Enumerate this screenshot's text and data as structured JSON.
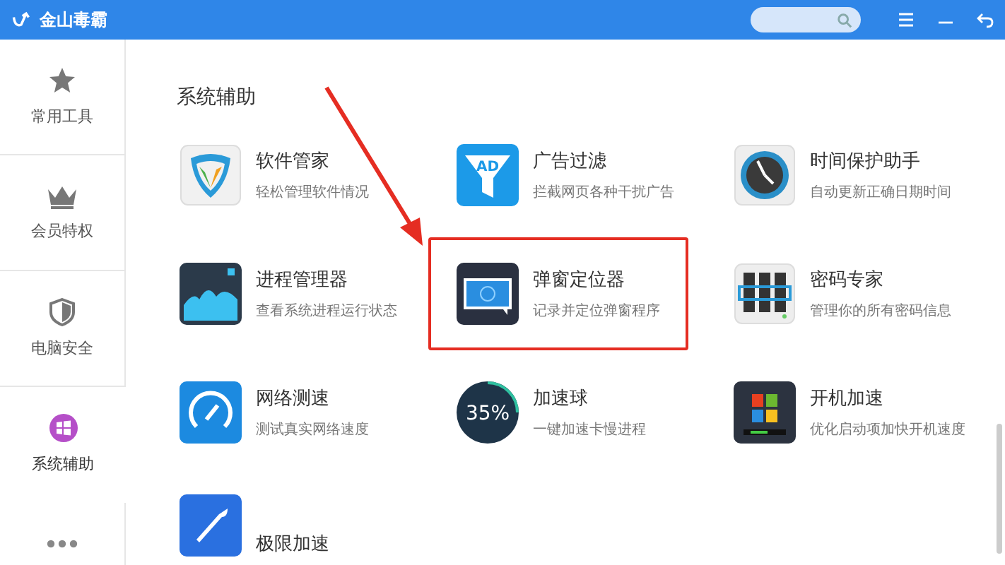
{
  "window": {
    "title": "金山毒霸"
  },
  "sidebar": {
    "items": [
      {
        "label": "常用工具",
        "kind": "star",
        "selected": false
      },
      {
        "label": "会员特权",
        "kind": "crown",
        "selected": false
      },
      {
        "label": "电脑安全",
        "kind": "shield",
        "selected": false
      },
      {
        "label": "系统辅助",
        "kind": "windows",
        "selected": true
      },
      {
        "kind": "more",
        "selected": false
      }
    ]
  },
  "section": {
    "heading": "系统辅助",
    "tools": [
      {
        "name": "软件管家",
        "desc": "轻松管理软件情况",
        "kind": "shield",
        "highlighted": false
      },
      {
        "name": "广告过滤",
        "desc": "拦截网页各种干扰广告",
        "kind": "ad",
        "icon_text": "AD",
        "highlighted": false
      },
      {
        "name": "时间保护助手",
        "desc": "自动更新正确日期时间",
        "kind": "clock",
        "highlighted": false
      },
      {
        "name": "进程管理器",
        "desc": "查看系统进程运行状态",
        "kind": "chart",
        "highlighted": false
      },
      {
        "name": "弹窗定位器",
        "desc": "记录并定位弹窗程序",
        "kind": "popup",
        "highlighted": true
      },
      {
        "name": "密码专家",
        "desc": "管理你的所有密码信息",
        "kind": "password",
        "highlighted": false
      },
      {
        "name": "网络测速",
        "desc": "测试真实网络速度",
        "kind": "gauge",
        "highlighted": false
      },
      {
        "name": "加速球",
        "desc": "一键加速卡慢进程",
        "kind": "ball",
        "icon_text": "35%",
        "highlighted": false
      },
      {
        "name": "开机加速",
        "desc": "优化启动项加快开机速度",
        "kind": "boot",
        "highlighted": false
      },
      {
        "name": "极限加速",
        "kind": "rocket",
        "highlighted": false
      }
    ]
  }
}
